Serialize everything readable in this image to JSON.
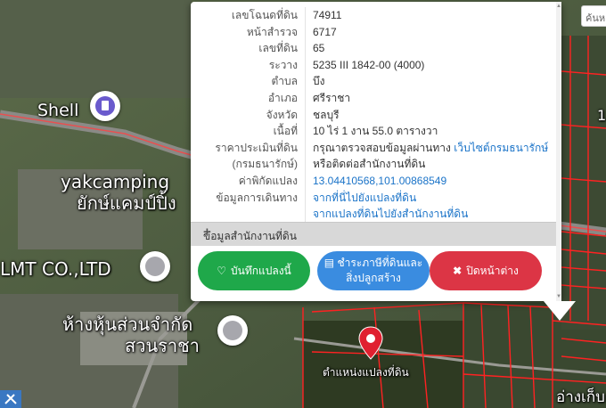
{
  "map": {
    "labels": {
      "shell": "Shell",
      "yakcamping_en": "yakcamping",
      "yakcamping_th": "ยักษ์แคมป์ปิ้ง",
      "lmt": "LMT CO.,LTD",
      "partnership_1": "ห้างหุ้นส่วนจำกัด",
      "partnership_2": "สวนราชา",
      "parcel_location": "ตำแหน่งแปลงที่ดิน",
      "edge_right": "1",
      "bottom_right": "อ่างเก็บ"
    },
    "search_placeholder": "ค้นห"
  },
  "popup": {
    "rows": [
      {
        "label": "เลขโฉนดที่ดิน",
        "value": "74911"
      },
      {
        "label": "หน้าสำรวจ",
        "value": "6717"
      },
      {
        "label": "เลขที่ดิน",
        "value": "65"
      },
      {
        "label": "ระวาง",
        "value": "5235 III 1842-00 (4000)"
      },
      {
        "label": "ตำบล",
        "value": "บึง"
      },
      {
        "label": "อำเภอ",
        "value": "ศรีราชา"
      },
      {
        "label": "จังหวัด",
        "value": "ชลบุรี"
      },
      {
        "label": "เนื้อที่",
        "value": "10 ไร่ 1 งาน 55.0 ตารางวา"
      }
    ],
    "appraisal": {
      "label_1": "ราคาประเมินที่ดิน",
      "label_2": "(กรมธนารักษ์)",
      "value_prefix": "กรุณาตรวจสอบข้อมูลผ่านทาง ",
      "value_link": "เว็บไซต์กรมธนารักษ์",
      "value_2": "หรือติดต่อสำนักงานที่ดิน"
    },
    "coords": {
      "label": "ค่าพิกัดแปลง",
      "value": "13.04410568,101.00868549"
    },
    "travel": {
      "label": "ข้อมูลการเดินทาง",
      "link_1": "จากที่นี่ไปยังแปลงที่ดิน",
      "link_2": "จากแปลงที่ดินไปยังสำนักงานที่ดิน"
    },
    "accordion_label": "ข้อมูลสำนักงานที่ดิน",
    "accordion_icon": "+",
    "buttons": {
      "save": "บันทึกแปลงนี้",
      "tax_1": "ชำระภาษีที่ดินและ",
      "tax_2": "สิ่งปลูกสร้าง",
      "close": "ปิดหน้าต่าง"
    }
  },
  "colors": {
    "save": "#1fa84a",
    "tax": "#3a8ce0",
    "close": "#dc3545",
    "link": "#1a73c8",
    "parcel_outline": "#ff2222"
  }
}
